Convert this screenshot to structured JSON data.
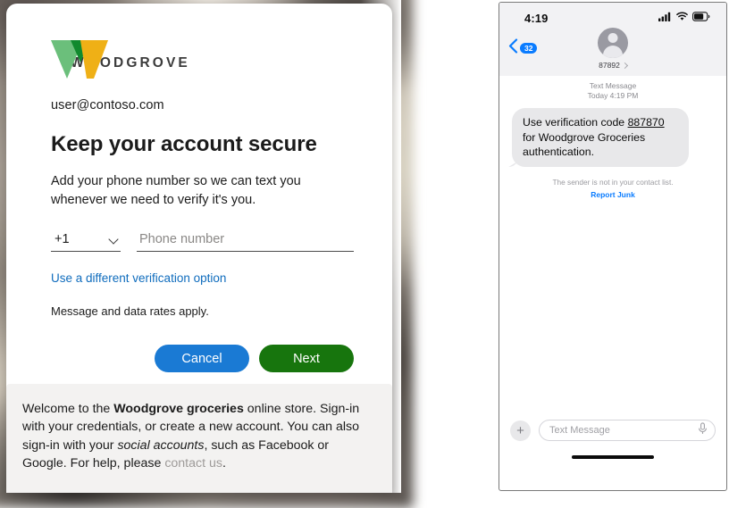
{
  "brand": {
    "name": "WOODGROVE",
    "logo_colors": {
      "light_green": "#6bbf7b",
      "dark_green": "#108a2e",
      "amber": "#efb016"
    }
  },
  "signin_card": {
    "account_email": "user@contoso.com",
    "title": "Keep your account secure",
    "subtitle": "Add your phone number so we can text you whenever we need to verify it's you.",
    "country_code": "+1",
    "phone_placeholder": "Phone number",
    "phone_value": "",
    "alt_verification_link": "Use a different verification option",
    "rates_note": "Message and data rates apply.",
    "buttons": {
      "cancel": "Cancel",
      "next": "Next"
    },
    "accent_colors": {
      "link": "#0f6cbd",
      "cancel": "#1a7ad4",
      "next": "#17750d"
    }
  },
  "notice": {
    "part1": "Welcome to the ",
    "bold1": "Woodgrove groceries",
    "part2": " online store. Sign-in with your credentials, or create a new account. You can also sign-in with your ",
    "italic1": "social accounts",
    "part3": ", such as Facebook or Google. For help, please ",
    "muted1": "contact us",
    "part4": "."
  },
  "phone": {
    "status": {
      "time": "4:19",
      "signal_icon": "cellular-signal-icon",
      "wifi_icon": "wifi-icon",
      "battery_icon": "battery-icon"
    },
    "nav": {
      "back_icon": "chevron-left-icon",
      "unread_badge": "32",
      "avatar_icon": "contact-avatar-icon",
      "contact_name": "87892",
      "detail_chevron": "chevron-right-icon"
    },
    "conversation": {
      "service_label": "Text Message",
      "timestamp": "Today 4:19 PM",
      "message_before_code": "Use verification code ",
      "verification_code": "887870",
      "message_after_code": " for Woodgrove Groceries authentication.",
      "sender_note": "The sender is not in your contact list.",
      "report_junk": "Report Junk"
    },
    "compose": {
      "add_icon": "plus-icon",
      "placeholder": "Text Message",
      "mic_icon": "microphone-icon"
    }
  }
}
